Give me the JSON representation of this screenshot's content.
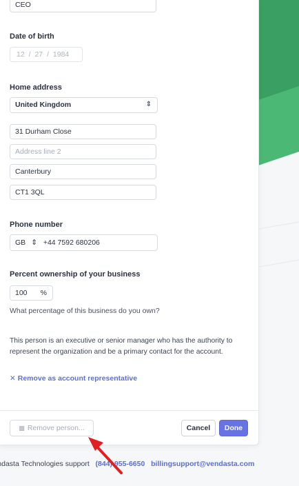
{
  "form": {
    "job_title_value": "CEO",
    "dob_label": "Date of birth",
    "dob": {
      "month": "12",
      "day": "27",
      "year": "1984",
      "sep": "/"
    },
    "home_address_label": "Home address",
    "country_value": "United Kingdom",
    "address_line1": "31 Durham Close",
    "address_line2_placeholder": "Address line 2",
    "city": "Canterbury",
    "postcode": "CT1 3QL",
    "phone_label": "Phone number",
    "phone_country": "GB",
    "phone_number": "+44  7592 680206",
    "ownership_label": "Percent ownership of your business",
    "ownership_value": "100",
    "ownership_unit": "%",
    "ownership_help": "What percentage of this business do you own?",
    "representative_text": "This person is an executive or senior manager who has the authority to represent the organization and be a primary contact for the account.",
    "remove_representative": "Remove as account representative"
  },
  "actions": {
    "remove_person": "Remove person...",
    "cancel": "Cancel",
    "done": "Done"
  },
  "footer": {
    "support_text": "Vendasta Technologies support",
    "phone_link": "(844) 955-6650",
    "email_link": "billingsupport@vendasta.com"
  },
  "colors": {
    "accent": "#6773e3",
    "green_dark": "#38a064",
    "green_light": "#49b773",
    "arrow": "#e02020"
  },
  "icons": [
    "chevron-updown-icon",
    "trash-icon",
    "close-x-icon",
    "red-arrow-annotation"
  ]
}
